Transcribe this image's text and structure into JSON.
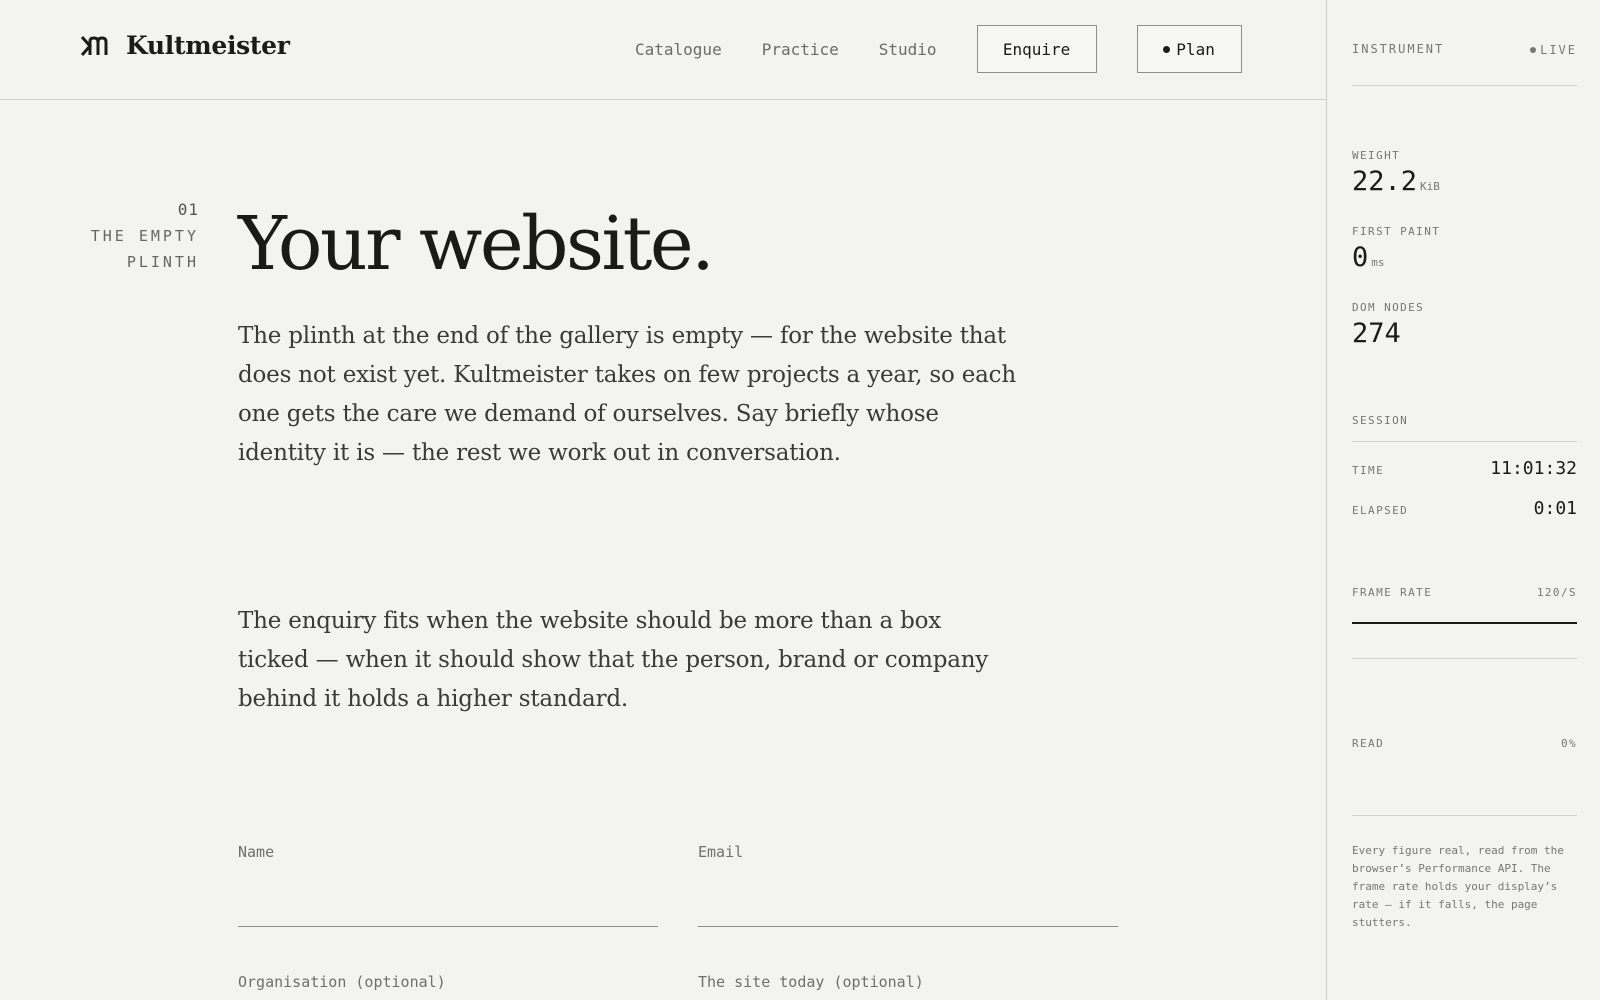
{
  "brand": {
    "name": "Kultmeister"
  },
  "nav": {
    "links": [
      "Catalogue",
      "Practice",
      "Studio"
    ],
    "enquire_label": "Enquire",
    "plan_label": "Plan"
  },
  "section": {
    "number": "01",
    "title_line1": "THE EMPTY",
    "title_line2": "PLINTH"
  },
  "main": {
    "headline": "Your website.",
    "paragraph1": "The plinth at the end of the gallery is empty — for the website that does not exist yet. Kultmeister takes on few projects a year, so each one gets the care we demand of ourselves. Say briefly whose identity it is — the rest we work out in conversation.",
    "paragraph2": "The enquiry fits when the website should be more than a box ticked — when it should show that the person, brand or company behind it holds a higher standard."
  },
  "form": {
    "name_label": "Name",
    "email_label": "Email",
    "organisation_label": "Organisation (optional)",
    "site_label": "The site today (optional)"
  },
  "instrument": {
    "title": "INSTRUMENT",
    "status": "LIVE",
    "weight_label": "WEIGHT",
    "weight_value": "22.2",
    "weight_unit": "KiB",
    "first_paint_label": "FIRST PAINT",
    "first_paint_value": "0",
    "first_paint_unit": "ms",
    "dom_nodes_label": "DOM NODES",
    "dom_nodes_value": "274",
    "session_label": "SESSION",
    "time_label": "TIME",
    "time_value": "11:01:32",
    "elapsed_label": "ELAPSED",
    "elapsed_value": "0:01",
    "frame_rate_label": "FRAME RATE",
    "frame_rate_value": "120/S",
    "read_label": "READ",
    "read_value": "0%",
    "footnote": "Every figure real, read from the browser’s Performance API. The frame rate holds your display’s rate — if it falls, the page stutters."
  },
  "colors": {
    "background": "#f3f3f2",
    "ink": "#1b1b1b",
    "rule": "#cfcfcd"
  }
}
